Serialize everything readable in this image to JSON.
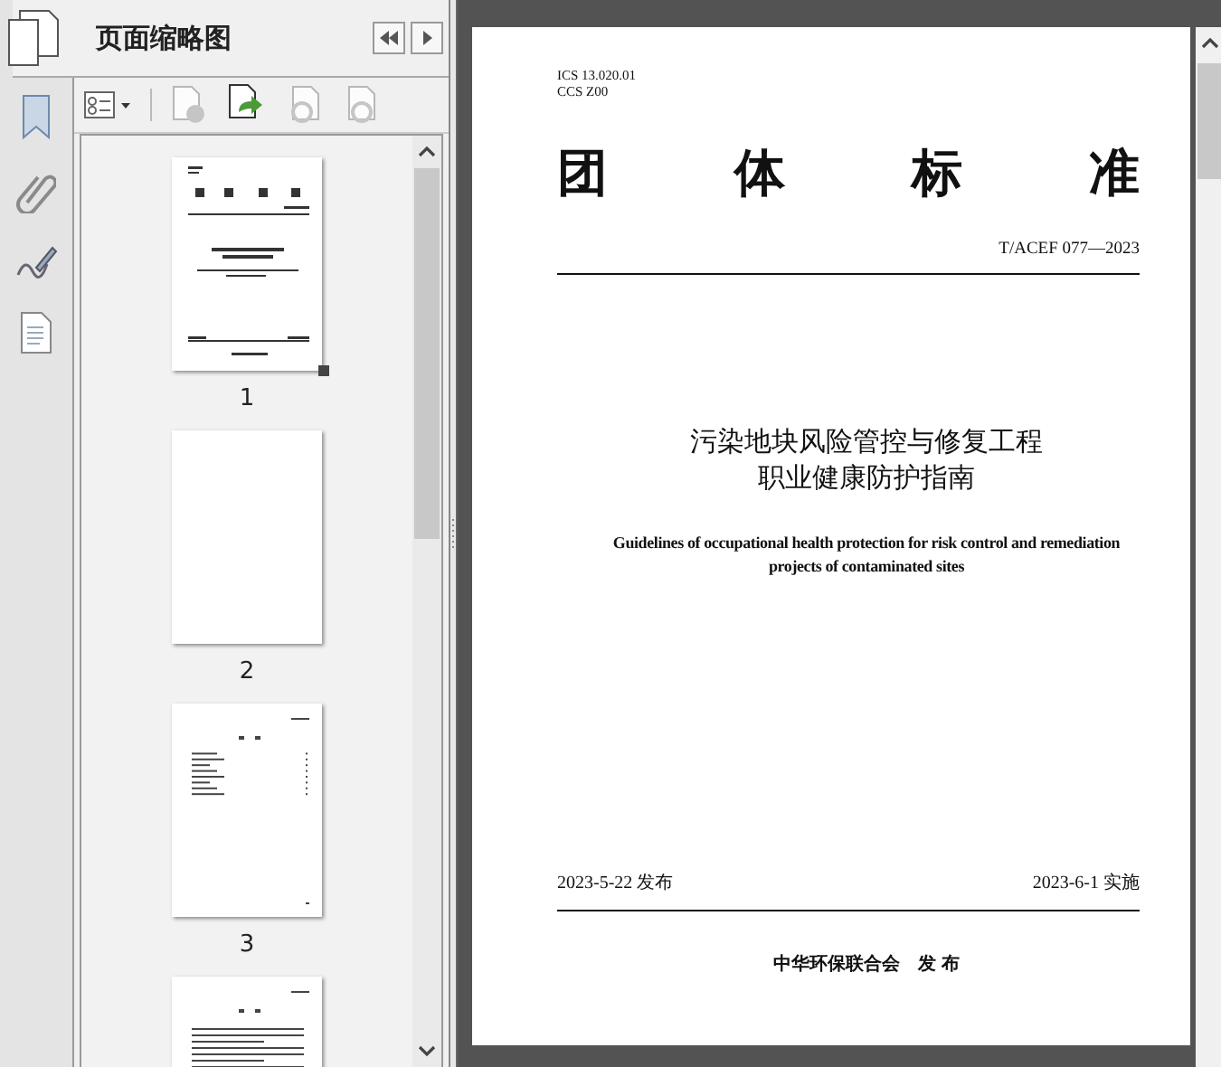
{
  "panel": {
    "title": "页面缩略图"
  },
  "thumbnails": [
    {
      "label": "1",
      "selected": true,
      "kind": "cover"
    },
    {
      "label": "2",
      "selected": false,
      "kind": "blank"
    },
    {
      "label": "3",
      "selected": false,
      "kind": "contents"
    },
    {
      "selected": false,
      "kind": "text"
    }
  ],
  "document": {
    "codes": [
      "ICS 13.020.01",
      "CCS Z00"
    ],
    "heading_chars": [
      "团",
      "体",
      "标",
      "准"
    ],
    "number": "T/ACEF 077—2023",
    "title_lines": [
      "污染地块风险管控与修复工程",
      "职业健康防护指南"
    ],
    "english_lines": [
      "Guidelines of occupational health protection for risk control and remediation",
      "projects of contaminated sites"
    ],
    "issued": "2023-5-22 发布",
    "effective": "2023-6-1 实施",
    "publisher": "中华环保联合会　发 布"
  }
}
